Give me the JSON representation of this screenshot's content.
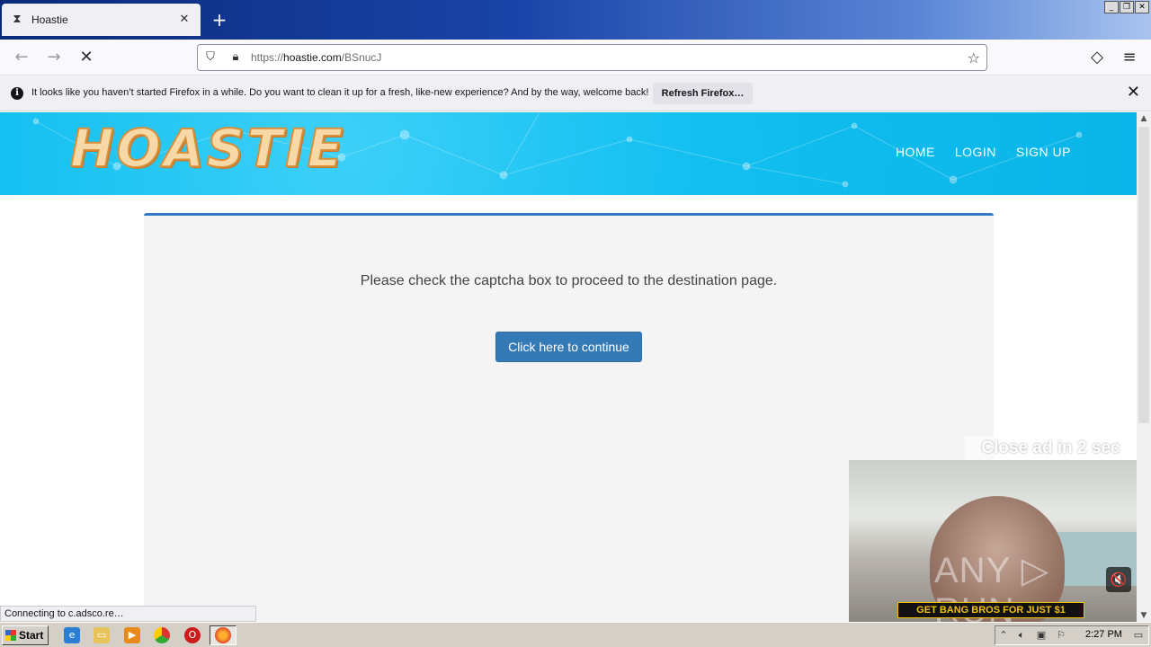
{
  "browser": {
    "tab": {
      "title": "Hoastie",
      "favicon": "hourglass-icon",
      "close": "✕"
    },
    "new_tab": "+",
    "window_controls": [
      "_",
      "❐",
      "✕"
    ],
    "nav": {
      "back": "←",
      "forward": "→",
      "stop": "✕"
    },
    "url": {
      "prefix": "https://",
      "host": "hoastie.com",
      "path": "/BSnucJ"
    },
    "bookmark_star": "☆",
    "pocket": "◇",
    "menu": "≡"
  },
  "notification": {
    "icon": "i",
    "message": "It looks like you haven’t started Firefox in a while. Do you want to clean it up for a fresh, like-new experience? And by the way, welcome back!",
    "button": "Refresh Firefox…",
    "close": "✕"
  },
  "site": {
    "logo": "HOASTIE",
    "nav": [
      "HOME",
      "LOGIN",
      "SIGN UP"
    ],
    "panel_message": "Please check the captcha box to proceed to the destination page.",
    "continue_button": "Click here to continue"
  },
  "ad": {
    "close_text": "Close ad in 2 sec",
    "watermark": "ANY ▷ RUN",
    "banner": "GET BANG BROS FOR JUST $1",
    "mute_icon": "🔇"
  },
  "status": "Connecting to c.adsco.re…",
  "taskbar": {
    "start": "Start",
    "clock": "2:27 PM"
  }
}
